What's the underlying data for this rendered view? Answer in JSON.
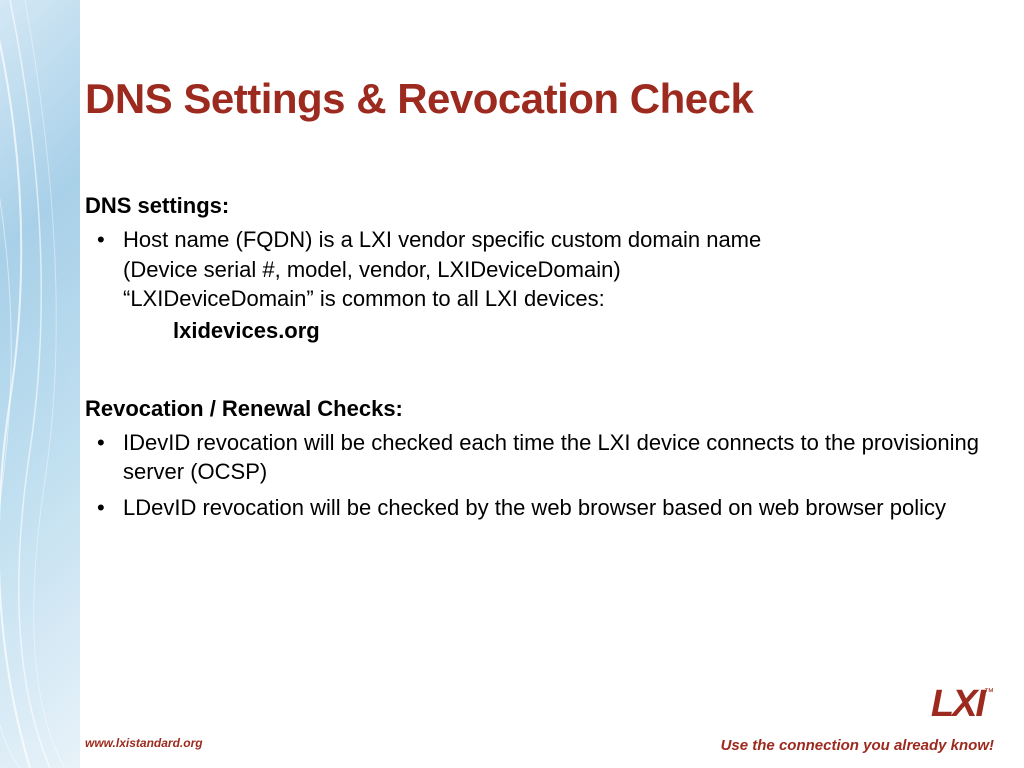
{
  "title": "DNS Settings  & Revocation Check",
  "section1": {
    "heading": "DNS settings:",
    "bullet1_line1": "Host name (FQDN) is a LXI vendor specific custom domain name",
    "bullet1_line2": "(Device serial #, model, vendor, LXIDeviceDomain)",
    "bullet1_line3": "“LXIDeviceDomain” is common to all LXI devices:",
    "bullet1_domain": "lxidevices.org"
  },
  "section2": {
    "heading": "Revocation / Renewal Checks:",
    "bullet1": "IDevID revocation will be checked each time the LXI device connects to the provisioning server (OCSP)",
    "bullet2": "LDevID revocation will be checked by the web browser based on web browser policy"
  },
  "footer": {
    "url": "www.lxistandard.org",
    "tagline": "Use the connection you already know!",
    "logo_text": "LXI",
    "logo_tm": "™"
  }
}
